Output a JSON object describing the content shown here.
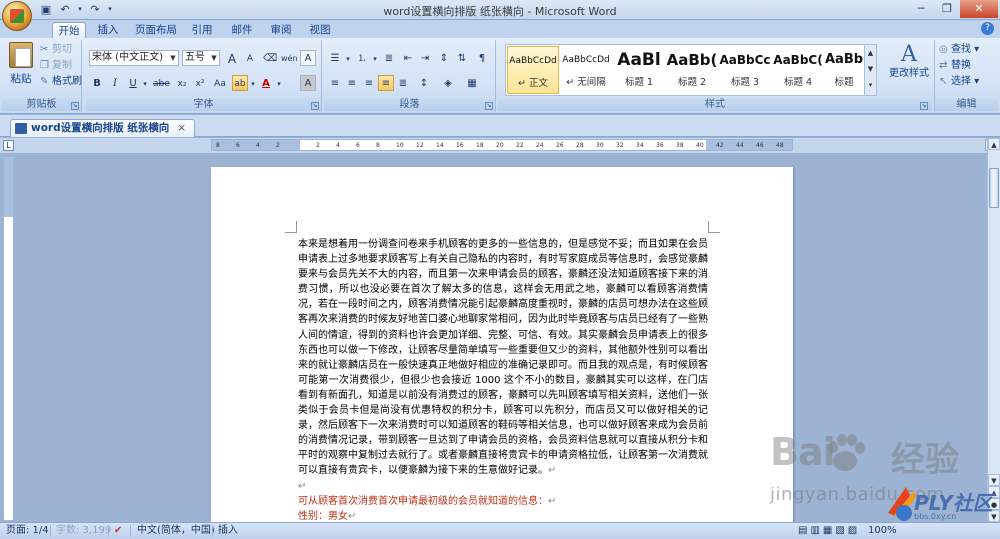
{
  "window": {
    "title": "word设置横向排版 纸张横向 - Microsoft Word"
  },
  "ribbon_tabs": [
    "开始",
    "插入",
    "页面布局",
    "引用",
    "邮件",
    "审阅",
    "视图"
  ],
  "clipboard": {
    "paste": "粘贴",
    "cut": "剪切",
    "copy": "复制",
    "format_painter": "格式刷",
    "label": "剪贴板"
  },
  "font": {
    "name": "宋体 (中文正文)",
    "size": "五号",
    "label": "字体",
    "bold": "B",
    "italic": "I",
    "underline": "U",
    "strike": "abe",
    "subscript": "x₂",
    "superscript": "x²",
    "change_case": "Aa",
    "highlight": "ab",
    "font_color": "A",
    "grow": "A",
    "shrink": "A",
    "phonetic": "wén",
    "char_border": "A"
  },
  "paragraph": {
    "label": "段落"
  },
  "styles": {
    "label": "样式",
    "items": [
      {
        "sample": "AaBbCcDd",
        "name": "↵ 正文"
      },
      {
        "sample": "AaBbCcDd",
        "name": "↵ 无间隔"
      },
      {
        "sample": "AaBl",
        "name": "标题 1"
      },
      {
        "sample": "AaBb(",
        "name": "标题 2"
      },
      {
        "sample": "AaBbCc",
        "name": "标题 3"
      },
      {
        "sample": "AaBbC(",
        "name": "标题 4"
      },
      {
        "sample": "AaBbC",
        "name": "标题"
      }
    ],
    "change_styles": "更改样式"
  },
  "editing": {
    "label": "编辑",
    "find": "查找",
    "replace": "替换",
    "select": "选择"
  },
  "document_tab": {
    "title": "word设置横向排版 纸张横向",
    "close": "×"
  },
  "ruler": {
    "ticks": [
      "8",
      "6",
      "4",
      "2",
      "",
      "2",
      "4",
      "6",
      "8",
      "10",
      "12",
      "14",
      "16",
      "18",
      "20",
      "22",
      "24",
      "26",
      "28",
      "30",
      "32",
      "34",
      "36",
      "38",
      "40",
      "42",
      "44",
      "46",
      "48"
    ]
  },
  "document": {
    "paragraph1": "本来是想着用一份调查问卷来手机顾客的更多的一些信息的，但是感觉不妥；而且如果在会员申请表上过多地要求顾客写上有关自己隐私的内容时，有时写家庭成员等信息时，会感觉豪麟要来与会员先关不大的内容，而且第一次来申请会员的顾客，豪麟还没法知道顾客接下来的消费习惯，所以也没必要在首次了解太多的信息，这样会无用武之地，豪麟可以看顾客消费情况，若在一段时间之内，顾客消费情况能引起豪麟高度重视时，豪麟的店员可想办法在这些顾客再次来消费的时候友好地苦口婆心地聊家常相问，因为此时毕竟顾客与店员已经有了一些熟人间的情谊，得到的资料也许会更加详细、完整、可信、有效。其实豪麟会员申请表上的很多东西也可以做一下修改，让顾客尽量简单填写一些重要但又少的资料，其他额外性别可以看出来的就让豪麟店员在一般快速真正地做好相应的准确记录即可。而且我的观点是，有时候顾客可能第一次消费很少，但很少也会接近 1000 这个不小的数目，豪麟其实可以这样，在门店看到有新面孔，知道是以前没有消费过的顾客，豪麟可以先叫顾客填写相关资料，送他们一张类似于会员卡但是尚没有优惠特权的积分卡，顾客可以先积分，而店员又可以做好相关的记录，然后顾客下一次来消费时可以知道顾客的鞋码等相关信息，也可以做好顾客来成为会员前的消费情况记录，带到顾客一旦达到了申请会员的资格，会员资料信息就可以直接从积分卡和平时的观察中复制过去就行了。或者豪麟直接将贵宾卡的申请资格拉低，让顾客第一次消费就可以直接有贵宾卡，以便豪麟为接下来的生意做好记录。",
    "pmark": "↵",
    "empty_line": "↵",
    "red_line1": "可从顾客首次消费首次申请最初级的会员就知道的信息：",
    "red_line2": "性别：男女"
  },
  "statusbar": {
    "page": "页面: 1/4",
    "words": "字数: 3,199",
    "language": "中文(简体，中国)",
    "insert_mode": "插入",
    "zoom": "100%"
  },
  "watermark": {
    "baidu": "Bai",
    "jingyan": "经验",
    "url": "jingyan.baidu.com",
    "site": "PLY社区",
    "site_url": "bbs.0xy.cn"
  },
  "colors": {
    "ribbon_bg": "#d5e3f6",
    "title_text": "#3b3b3b",
    "red_text": "#c0301a",
    "close_button": "#c9442a"
  }
}
